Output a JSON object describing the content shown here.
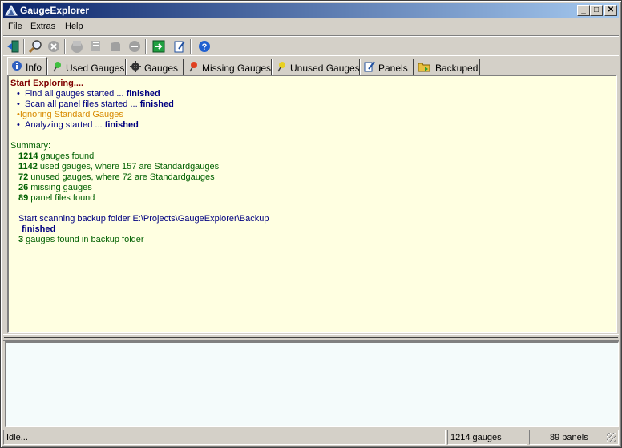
{
  "window": {
    "title": "GaugeExplorer",
    "minimize": "_",
    "maximize": "□",
    "close": "✕"
  },
  "menu": [
    "File",
    "Extras",
    "Help"
  ],
  "toolbar": [
    {
      "name": "exit-icon"
    },
    {
      "name": "search-icon"
    },
    {
      "name": "stop-icon"
    },
    {
      "name": "gauge-icon"
    },
    {
      "name": "panel-icon"
    },
    {
      "name": "backup-icon"
    },
    {
      "name": "remove-icon"
    },
    {
      "name": "export-icon"
    },
    {
      "name": "edit-icon"
    },
    {
      "name": "help-icon"
    }
  ],
  "tabs": [
    {
      "label": "Info",
      "icon": "info-icon",
      "active": true
    },
    {
      "label": "Used Gauges",
      "icon": "green-pin-icon"
    },
    {
      "label": "Gauges",
      "icon": "gear-icon"
    },
    {
      "label": "Missing Gauges",
      "icon": "red-pin-icon"
    },
    {
      "label": "Unused Gauges",
      "icon": "yellow-pin-icon"
    },
    {
      "label": "Panels",
      "icon": "pencil-icon"
    },
    {
      "label": "Backuped",
      "icon": "folder-icon"
    }
  ],
  "info": {
    "heading": "Start Exploring....",
    "steps": [
      {
        "text": "Find all gauges started ... ",
        "status": "finished"
      },
      {
        "text": "Scan all panel files started ... ",
        "status": "finished"
      },
      {
        "text": "Ignoring Standard Gauges",
        "status": ""
      },
      {
        "text": "Analyzing started ... ",
        "status": "finished"
      }
    ],
    "summary_label": "Summary:",
    "summary": [
      {
        "count": "1214",
        "text": " gauges found"
      },
      {
        "count": "1142",
        "text": " used gauges, where 157 are Standardgauges"
      },
      {
        "count": "72",
        "text": " unused gauges, where 72 are Standardgauges"
      },
      {
        "count": "26",
        "text": " missing gauges"
      },
      {
        "count": "89",
        "text": " panel files found"
      }
    ],
    "backup_scan": "Start scanning backup folder E:\\Projects\\GaugeExplorer\\Backup",
    "backup_finished": "finished",
    "backup_count": "3",
    "backup_text": " gauges found in backup folder"
  },
  "status": {
    "state": "Idle...",
    "gauges": "1214 gauges",
    "panels": "89 panels"
  }
}
